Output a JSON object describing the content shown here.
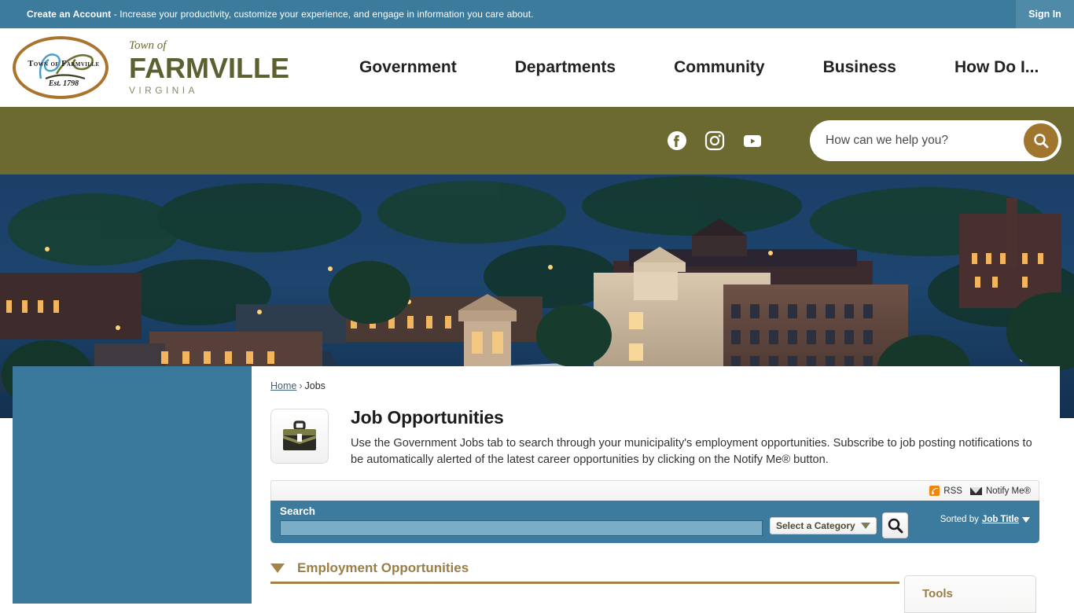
{
  "topbar": {
    "create_account_label": "Create an Account",
    "message": " - Increase your productivity, customize your experience, and engage in information you care about.",
    "signin_label": "Sign In",
    "bg_color": "#3d7b9c"
  },
  "header": {
    "seal_arc_text": "Town of Farmville",
    "seal_est_text": "Est. 1798",
    "wordmark_town": "Town of",
    "wordmark_name": "FARMVILLE",
    "wordmark_state": "VIRGINIA",
    "nav": [
      {
        "label": "Government"
      },
      {
        "label": "Departments"
      },
      {
        "label": "Community"
      },
      {
        "label": "Business"
      },
      {
        "label": "How Do I..."
      }
    ]
  },
  "utility": {
    "bg_color": "#6c6a30",
    "socials": [
      {
        "name": "facebook-icon"
      },
      {
        "name": "instagram-icon"
      },
      {
        "name": "youtube-icon"
      }
    ],
    "search_placeholder": "How can we help you?",
    "search_value": "",
    "search_button_color": "#a0762f"
  },
  "breadcrumb": {
    "home": "Home",
    "separator": "›",
    "current": "Jobs"
  },
  "page": {
    "title": "Job Opportunities",
    "description": "Use the Government Jobs tab to search through your municipality's employment opportunities. Subscribe to job posting notifications to be automatically alerted of the latest career opportunities by clicking on the Notify Me® button.",
    "icon": "briefcase-icon"
  },
  "module_bar": {
    "rss_label": "RSS",
    "notify_label": "Notify Me®"
  },
  "search_module": {
    "label": "Search",
    "input_value": "",
    "category_label": "Select a Category",
    "go_label": "search-icon",
    "sorted_by_prefix": "Sorted by",
    "sorted_by_value": "Job Title",
    "accent_color": "#3c7b9d"
  },
  "sections": {
    "employment_title": "Employment Opportunities",
    "tools_title": "Tools",
    "accent_color": "#a38447"
  }
}
